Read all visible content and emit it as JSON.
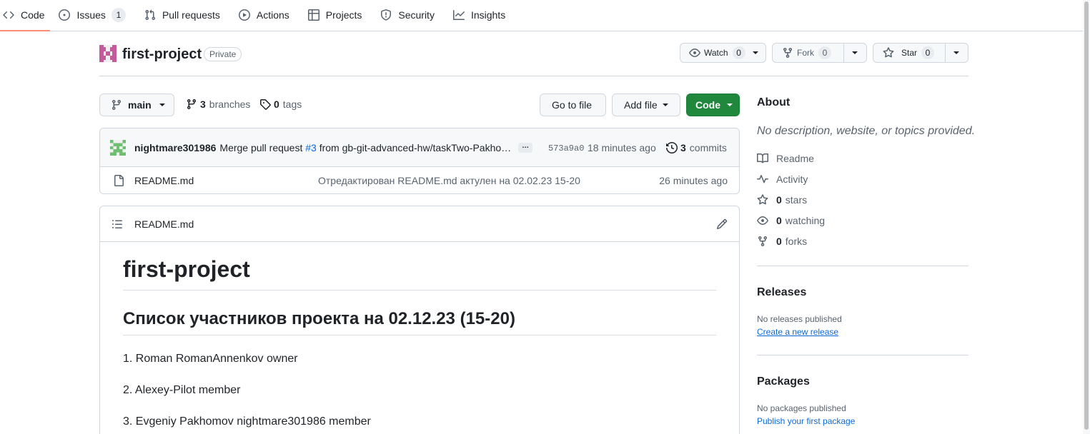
{
  "nav": {
    "tabs": [
      {
        "label": "Code",
        "icon": "code-icon"
      },
      {
        "label": "Issues",
        "icon": "issue-icon",
        "count": "1"
      },
      {
        "label": "Pull requests",
        "icon": "pull-request-icon"
      },
      {
        "label": "Actions",
        "icon": "play-icon"
      },
      {
        "label": "Projects",
        "icon": "table-icon"
      },
      {
        "label": "Security",
        "icon": "shield-icon"
      },
      {
        "label": "Insights",
        "icon": "graph-icon"
      }
    ]
  },
  "repo": {
    "name": "first-project",
    "visibility": "Private",
    "watch_label": "Watch",
    "watch_count": "0",
    "fork_label": "Fork",
    "fork_count": "0",
    "star_label": "Star",
    "star_count": "0"
  },
  "branchbar": {
    "branch": "main",
    "branches_count": "3",
    "branches_label": "branches",
    "tags_count": "0",
    "tags_label": "tags",
    "go_to_file": "Go to file",
    "add_file": "Add file",
    "code": "Code"
  },
  "commit": {
    "author": "nightmare301986",
    "msg_prefix": "Merge pull request",
    "issue_ref": "#3",
    "msg_suffix": "from gb-git-advanced-hw/taskTwo-Pakho…",
    "ellipsis": "…",
    "sha": "573a9a0",
    "time_ago": "18 minutes ago",
    "commits_count": "3",
    "commits_label": "commits"
  },
  "files": [
    {
      "name": "README.md",
      "message": "Отредактирован README.md актулен на 02.02.23 15-20",
      "time_ago": "26 minutes ago"
    }
  ],
  "readme": {
    "filename": "README.md",
    "h1": "first-project",
    "h2": "Список участников проекта на 02.12.23 (15-20)",
    "items": [
      "1. Roman RomanAnnenkov owner",
      "2. Alexey-Pilot member",
      "3. Evgeniy Pakhomov nightmare301986 member"
    ]
  },
  "about": {
    "title": "About",
    "description": "No description, website, or topics provided.",
    "readme": "Readme",
    "activity": "Activity",
    "stars_count": "0",
    "stars_label": "stars",
    "watching_count": "0",
    "watching_label": "watching",
    "forks_count": "0",
    "forks_label": "forks"
  },
  "releases": {
    "title": "Releases",
    "empty": "No releases published",
    "link": "Create a new release"
  },
  "packages": {
    "title": "Packages",
    "empty": "No packages published",
    "link": "Publish your first package"
  },
  "colors": {
    "accent_tab": "#fd8c73",
    "primary_button": "#1f883d",
    "link": "#0969da",
    "border": "#d0d7de"
  }
}
